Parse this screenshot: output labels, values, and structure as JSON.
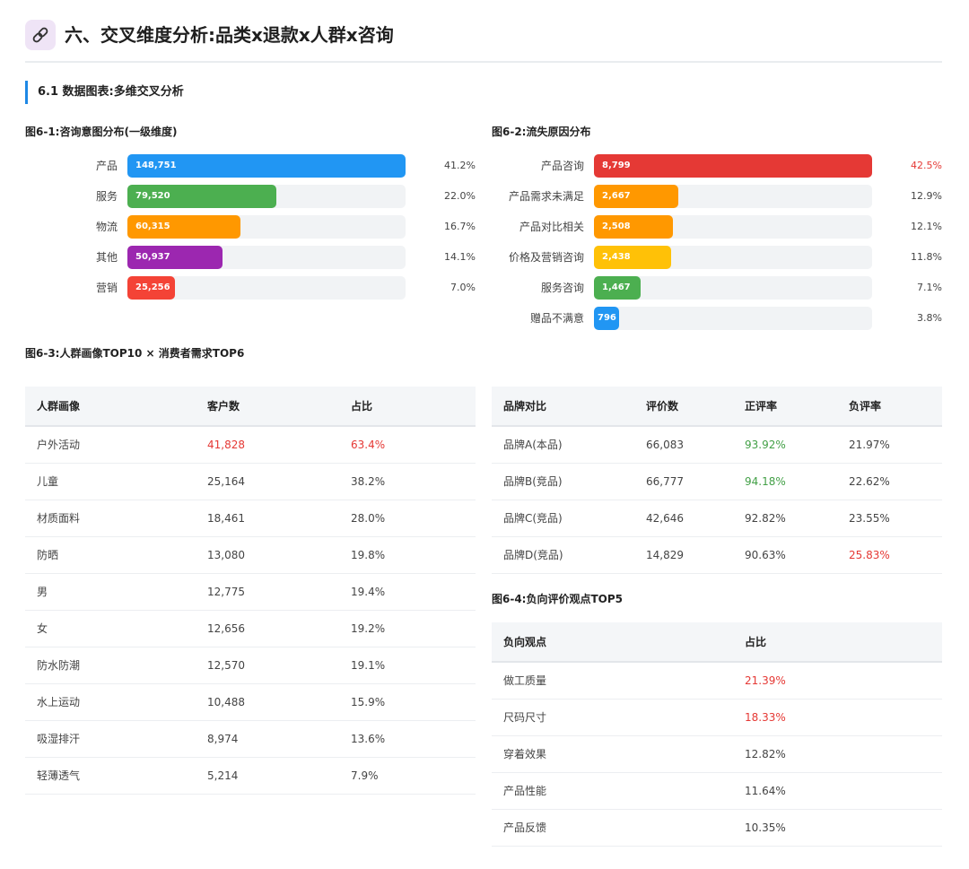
{
  "header": {
    "title": "六、交叉维度分析:品类x退款x人群x咨询",
    "icon": "link-icon"
  },
  "section": {
    "title": "6.1 数据图表:多维交叉分析"
  },
  "fig1": {
    "title": "图6-1:咨询意图分布(一级维度)",
    "chart_data": {
      "type": "bar",
      "orientation": "horizontal",
      "title": "图6-1:咨询意图分布(一级维度)",
      "categories": [
        "产品",
        "服务",
        "物流",
        "其他",
        "营销"
      ],
      "values": [
        148751,
        79520,
        60315,
        50937,
        25256
      ],
      "value_labels": [
        "148,751",
        "79,520",
        "60,315",
        "50,937",
        "25,256"
      ],
      "percent_labels": [
        "41.2%",
        "22.0%",
        "16.7%",
        "14.1%",
        "7.0%"
      ],
      "colors": [
        "#2196f3",
        "#4caf50",
        "#ff9800",
        "#9c27b0",
        "#f44336"
      ],
      "max": 148751
    }
  },
  "fig2": {
    "title": "图6-2:流失原因分布",
    "chart_data": {
      "type": "bar",
      "orientation": "horizontal",
      "title": "图6-2:流失原因分布",
      "categories": [
        "产品咨询",
        "产品需求未满足",
        "产品对比相关",
        "价格及营销咨询",
        "服务咨询",
        "赠品不满意"
      ],
      "values": [
        8799,
        2667,
        2508,
        2438,
        1467,
        796
      ],
      "value_labels": [
        "8,799",
        "2,667",
        "2,508",
        "2,438",
        "1,467",
        "796"
      ],
      "percent_labels": [
        "42.5%",
        "12.9%",
        "12.1%",
        "11.8%",
        "7.1%",
        "3.8%"
      ],
      "colors": [
        "#e53935",
        "#ff9800",
        "#ff9800",
        "#ffc107",
        "#4caf50",
        "#2196f3"
      ],
      "highlight_pct_index": 0,
      "max": 8799
    }
  },
  "fig3": {
    "title": "图6-3:人群画像TOP10 × 消费者需求TOP6",
    "table": {
      "headers": [
        "人群画像",
        "客户数",
        "占比"
      ],
      "rows": [
        [
          "户外活动",
          "41,828",
          "63.4%"
        ],
        [
          "儿童",
          "25,164",
          "38.2%"
        ],
        [
          "材质面料",
          "18,461",
          "28.0%"
        ],
        [
          "防晒",
          "13,080",
          "19.8%"
        ],
        [
          "男",
          "12,775",
          "19.4%"
        ],
        [
          "女",
          "12,656",
          "19.2%"
        ],
        [
          "防水防潮",
          "12,570",
          "19.1%"
        ],
        [
          "水上运动",
          "10,488",
          "15.9%"
        ],
        [
          "吸湿排汗",
          "8,974",
          "13.6%"
        ],
        [
          "轻薄透气",
          "5,214",
          "7.9%"
        ]
      ]
    }
  },
  "brand_table": {
    "headers": [
      "品牌对比",
      "评价数",
      "正评率",
      "负评率"
    ],
    "rows": [
      [
        "品牌A(本品)",
        "66,083",
        "93.92%",
        "21.97%"
      ],
      [
        "品牌B(竞品)",
        "66,777",
        "94.18%",
        "22.62%"
      ],
      [
        "品牌C(竞品)",
        "42,646",
        "92.82%",
        "23.55%"
      ],
      [
        "品牌D(竞品)",
        "14,829",
        "90.63%",
        "25.83%"
      ]
    ]
  },
  "fig4": {
    "title": "图6-4:负向评价观点TOP5",
    "table": {
      "headers": [
        "负向观点",
        "占比"
      ],
      "rows": [
        [
          "做工质量",
          "21.39%"
        ],
        [
          "尺码尺寸",
          "18.33%"
        ],
        [
          "穿着效果",
          "12.82%"
        ],
        [
          "产品性能",
          "11.64%"
        ],
        [
          "产品反馈",
          "10.35%"
        ]
      ]
    }
  },
  "colors": {
    "accent": "#1e88e5",
    "red": "#e53935",
    "green": "#43a047"
  }
}
